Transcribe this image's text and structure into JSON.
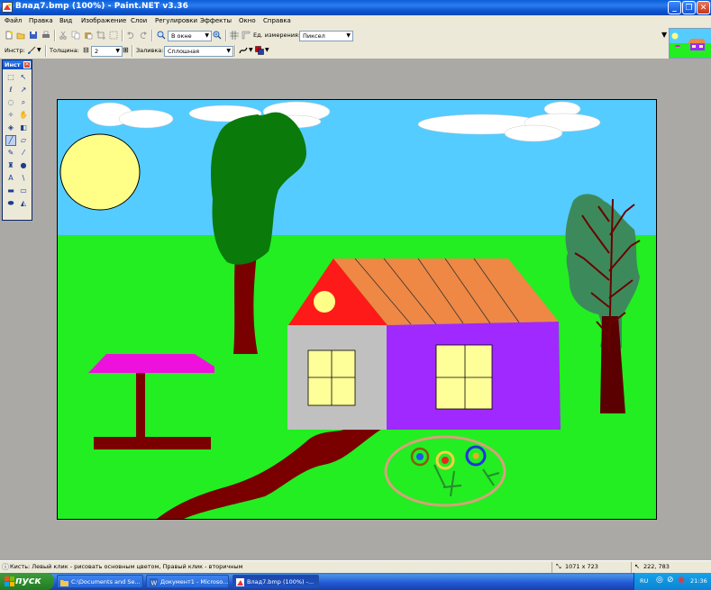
{
  "window": {
    "title": "Влад7.bmp (100%) - Paint.NET v3.36",
    "btn_min": "_",
    "btn_max": "❐",
    "btn_close": "✕"
  },
  "menu": [
    "Файл",
    "Правка",
    "Вид",
    "Изображение",
    "Слои",
    "Регулировки",
    "Эффекты",
    "Окно",
    "Справка"
  ],
  "toolbar1": {
    "zoom_value": "В окне",
    "units_label": "Ед. измерения:",
    "units_value": "Пиксел"
  },
  "toolbar2": {
    "tool_label": "Инстр:",
    "width_label": "Толщина:",
    "width_value": "2",
    "minus": "⊟",
    "plus": "⊞",
    "fill_label": "Заливка:",
    "fill_value": "Сплошная"
  },
  "tools_window": {
    "title": "Инст",
    "close": "✕"
  },
  "status": {
    "hint": "Кисть: Левый клик - рисовать основным цветом, Правый клик - вторичным",
    "image_size": "1071 x 723",
    "cursor_pos": "222, 783"
  },
  "taskbar": {
    "start_label": "пуск",
    "tasks": [
      {
        "label": "C:\\Documents and Se..."
      },
      {
        "label": "Документ1 - Microso..."
      },
      {
        "label": "Влад7.bmp (100%) -..."
      }
    ],
    "lang": "RU",
    "clock": "21:36"
  },
  "colors": {
    "sky": "#55ccff",
    "grass": "#22ee22",
    "roof": "#ee8844",
    "wall_left": "#c0c0c0",
    "wall_right": "#a029ff",
    "window_fill": "#ffff99",
    "sun": "#ffff88",
    "path": "#7a0000",
    "umbrella": "#ee11dd"
  }
}
